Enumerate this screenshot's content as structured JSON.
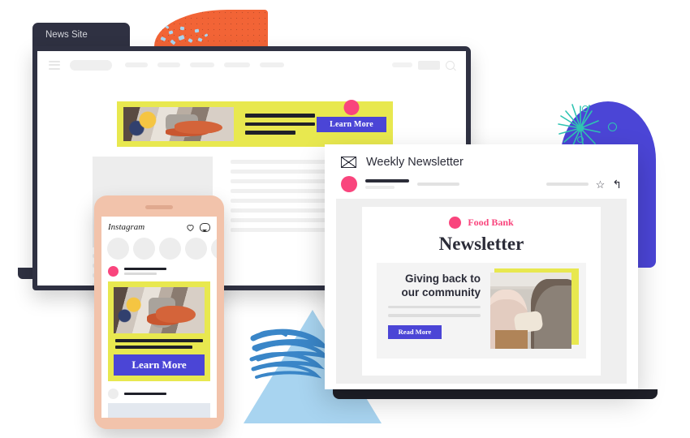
{
  "browser": {
    "tab_label": "News Site",
    "nav": {
      "hamburger_icon": "hamburger-menu-icon",
      "logo_placeholder": "",
      "items": [
        "",
        "",
        "",
        "",
        ""
      ],
      "search_icon": "search-icon"
    },
    "banner_ad": {
      "image_alt": "volunteers-serving-soup-photo",
      "headline_lines": [
        "",
        "",
        ""
      ],
      "cta_label": "Learn More",
      "accent_dot": "brand-dot",
      "background_color": "#e8e84f",
      "button_color": "#4b45d6",
      "dot_color": "#f9457d"
    },
    "article": {
      "hero_image_alt": "article-hero-placeholder",
      "body_lines": [
        "",
        "",
        "",
        "",
        "",
        "",
        "",
        ""
      ],
      "side_lines": [
        "",
        "",
        "",
        ""
      ]
    }
  },
  "phone": {
    "app_name": "Instagram",
    "icons": {
      "like": "heart-icon",
      "message": "message-bubble-icon"
    },
    "stories": [
      "",
      "",
      "",
      "",
      ""
    ],
    "post": {
      "username_line": "",
      "subtitle_line": "",
      "ad": {
        "image_alt": "volunteers-serving-soup-photo",
        "caption_lines": [
          "",
          ""
        ],
        "cta_label": "Learn More",
        "background_color": "#e8e84f",
        "button_color": "#4b45d6"
      }
    },
    "next_post": {
      "username_line": ""
    },
    "case_color": "#f2c3ab"
  },
  "mail": {
    "window_title": "Weekly Newsletter",
    "envelope_icon": "envelope-icon",
    "sender_avatar": "avatar",
    "sender_line": "",
    "subject_line": "",
    "meta_line": "",
    "actions": {
      "star_icon": "star-icon",
      "star_glyph": "☆",
      "reply_icon": "reply-arrow-icon",
      "reply_glyph": "↰"
    },
    "newsletter": {
      "brand_name": "Food Bank",
      "brand_dot_color": "#f9457d",
      "title": "Newsletter",
      "feature": {
        "headline": "Giving back to our community",
        "body_lines": [
          "",
          ""
        ],
        "cta_label": "Read More",
        "image_alt": "community-food-donation-photo",
        "accent_color": "#e8e84f",
        "button_color": "#4b45d6"
      }
    }
  },
  "decor": {
    "orange_blob": {
      "name": "orange-blob-shape",
      "color": "#f26436"
    },
    "blue_arch": {
      "name": "blue-arch-shape",
      "color": "#4b45d6"
    },
    "teal_burst": {
      "name": "teal-sparkle-shape",
      "color": "#2fc4b2"
    },
    "triangle": {
      "name": "light-blue-triangle-shape",
      "color": "#a8d4f0"
    },
    "scribble": {
      "name": "blue-scribble-shape",
      "color": "#3a86c8"
    },
    "confetti": {
      "name": "confetti-shape",
      "color": "#a8d4f0"
    }
  }
}
